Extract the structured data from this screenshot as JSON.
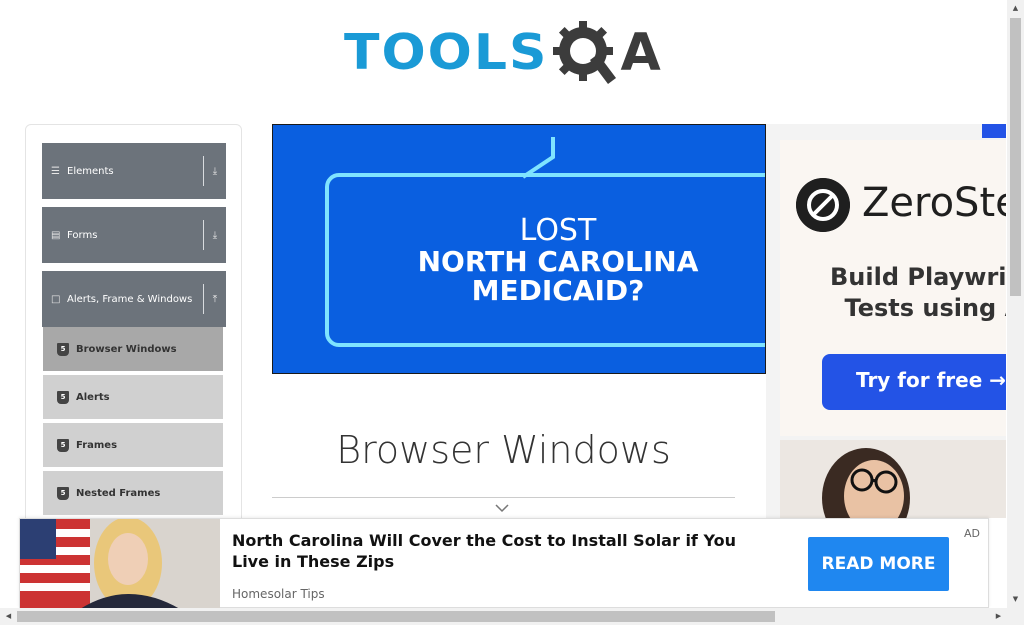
{
  "header": {
    "logo_text": "TOOLS",
    "logo_suffix": "A"
  },
  "sidebar": {
    "groups": [
      {
        "label": "Elements",
        "icon": "menu-icon",
        "arrow": "download-arrow-icon"
      },
      {
        "label": "Forms",
        "icon": "form-icon",
        "arrow": "download-arrow-icon"
      },
      {
        "label": "Alerts, Frame & Windows",
        "icon": "window-icon",
        "arrow": "upload-arrow-icon"
      }
    ],
    "items": [
      {
        "label": "Browser Windows",
        "icon": "html5-icon",
        "active": true
      },
      {
        "label": "Alerts",
        "icon": "html5-icon"
      },
      {
        "label": "Frames",
        "icon": "html5-icon"
      },
      {
        "label": "Nested Frames",
        "icon": "html5-icon"
      }
    ]
  },
  "banner_ad": {
    "line1": "LOST",
    "line2": "NORTH CAROLINA",
    "line3": "MEDICAID?"
  },
  "side_ad": {
    "brand": "ZeroSte",
    "tagline_1": "Build Playwrig",
    "tagline_2": "Tests using A",
    "cta": "Try for free →"
  },
  "main": {
    "title": "Browser Windows"
  },
  "bottom_ad": {
    "title": "North Carolina Will Cover the Cost to Install Solar if You Live in These Zips",
    "source": "Homesolar Tips",
    "cta": "READ MORE",
    "tag": "AD"
  },
  "colors": {
    "logo_blue": "#1a9ad6",
    "sidebar_group": "#6c737b",
    "sidebar_item": "#d0d0d0",
    "sidebar_item_active": "#a8a8a8",
    "cta_blue": "#1f87f0"
  }
}
